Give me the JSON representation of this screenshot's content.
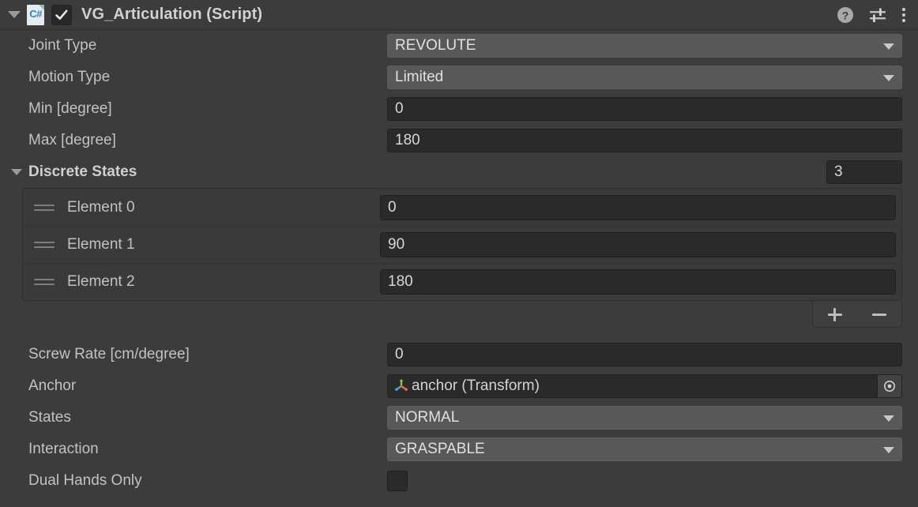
{
  "component": {
    "title": "VG_Articulation (Script)",
    "script_icon": "csharp-script-icon",
    "enabled": true,
    "foldout_expanded": true,
    "header_icons": [
      "help-icon",
      "preset-icon",
      "more-menu-icon"
    ]
  },
  "properties": {
    "joint_type": {
      "label": "Joint Type",
      "value": "REVOLUTE",
      "control": "dropdown"
    },
    "motion_type": {
      "label": "Motion Type",
      "value": "Limited",
      "control": "dropdown"
    },
    "min_degree": {
      "label": "Min [degree]",
      "value": "0",
      "control": "number"
    },
    "max_degree": {
      "label": "Max [degree]",
      "value": "180",
      "control": "number"
    },
    "screw_rate": {
      "label": "Screw Rate [cm/degree]",
      "value": "0",
      "control": "number"
    },
    "anchor": {
      "label": "Anchor",
      "value": "anchor (Transform)",
      "control": "object",
      "icon": "transform-gizmo-icon"
    },
    "states": {
      "label": "States",
      "value": "NORMAL",
      "control": "dropdown"
    },
    "interaction": {
      "label": "Interaction",
      "value": "GRASPABLE",
      "control": "dropdown"
    },
    "dual_hands_only": {
      "label": "Dual Hands Only",
      "value": "",
      "control": "checkbox",
      "checked": false
    }
  },
  "discrete_states": {
    "label": "Discrete States",
    "size": "3",
    "expanded": true,
    "elements": [
      {
        "label": "Element 0",
        "value": "0"
      },
      {
        "label": "Element 1",
        "value": "90"
      },
      {
        "label": "Element 2",
        "value": "180"
      }
    ],
    "add_button": "+",
    "remove_button": "−"
  },
  "colors": {
    "background": "#3c3c3c",
    "dropdown": "#585858",
    "input": "#2a2a2a",
    "label_text": "#c2c2c2",
    "gizmo_green": "#8cc63f",
    "gizmo_blue": "#4aa3df",
    "gizmo_orange": "#e8703a",
    "csharp_blue": "#2e86b8"
  }
}
